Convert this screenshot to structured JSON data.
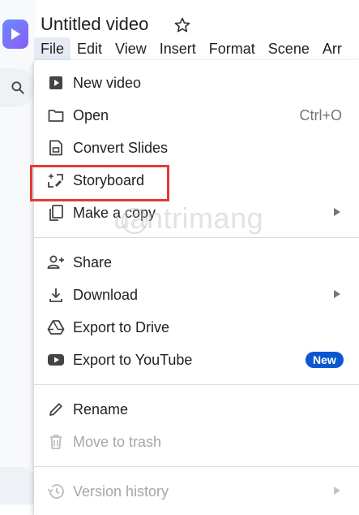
{
  "header": {
    "title": "Untitled video"
  },
  "menubar": {
    "items": [
      {
        "label": "File"
      },
      {
        "label": "Edit"
      },
      {
        "label": "View"
      },
      {
        "label": "Insert"
      },
      {
        "label": "Format"
      },
      {
        "label": "Scene"
      },
      {
        "label": "Arr"
      }
    ],
    "active": "File"
  },
  "file_menu": {
    "items": [
      {
        "label": "New video",
        "icon": "play-box-icon"
      },
      {
        "label": "Open",
        "icon": "folder-icon",
        "shortcut": "Ctrl+O"
      },
      {
        "label": "Convert Slides",
        "icon": "slides-icon"
      },
      {
        "label": "Storyboard",
        "icon": "sparkle-storyboard-icon",
        "highlighted": true
      },
      {
        "label": "Make a copy",
        "icon": "copy-icon",
        "submenu": true
      },
      {
        "label": "Share",
        "icon": "person-add-icon"
      },
      {
        "label": "Download",
        "icon": "download-icon",
        "submenu": true
      },
      {
        "label": "Export to Drive",
        "icon": "drive-icon"
      },
      {
        "label": "Export to YouTube",
        "icon": "youtube-icon",
        "badge": "New"
      },
      {
        "label": "Rename",
        "icon": "pencil-icon"
      },
      {
        "label": "Move to trash",
        "icon": "trash-icon",
        "disabled": true
      },
      {
        "label": "Version history",
        "icon": "history-icon",
        "submenu": true,
        "disabled": true
      }
    ]
  },
  "watermark": "uantrimang",
  "colors": {
    "accent": "#0b57d0",
    "highlight_border": "#e53935",
    "active_menu_bg": "#e6ebf3",
    "disabled_text": "#a6a6a6"
  }
}
